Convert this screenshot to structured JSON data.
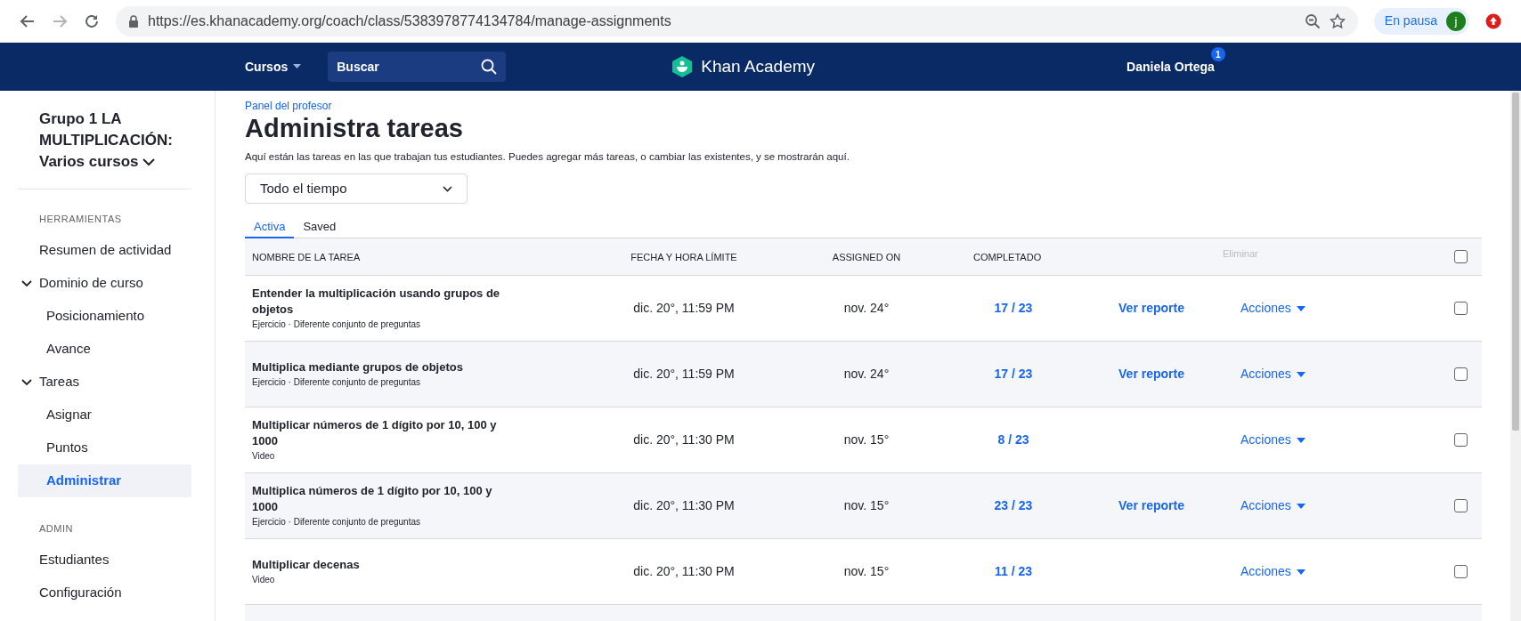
{
  "browser": {
    "url": "https://es.khanacademy.org/coach/class/5383978774134784/manage-assignments",
    "profile_status": "En pausa",
    "avatar_letter": "j"
  },
  "header": {
    "courses_menu": "Cursos",
    "search_placeholder": "Buscar",
    "logo": "Khan Academy",
    "user": "Daniela Ortega",
    "notification_count": "1"
  },
  "sidebar": {
    "class_title": "Grupo 1 LA MULTIPLICACIÓN: Varios cursos",
    "sections": [
      {
        "heading": "HERRAMIENTAS",
        "items": [
          {
            "label": "Resumen de actividad",
            "selected": false
          },
          {
            "label": "Dominio de curso",
            "selected": false,
            "expanded": true,
            "children": [
              {
                "label": "Posicionamiento",
                "selected": false
              },
              {
                "label": "Avance",
                "selected": false
              }
            ]
          },
          {
            "label": "Tareas",
            "selected": false,
            "expanded": true,
            "children": [
              {
                "label": "Asignar",
                "selected": false
              },
              {
                "label": "Puntos",
                "selected": false
              },
              {
                "label": "Administrar",
                "selected": true
              }
            ]
          }
        ]
      },
      {
        "heading": "ADMIN",
        "items": [
          {
            "label": "Estudiantes",
            "selected": false
          },
          {
            "label": "Configuración",
            "selected": false
          }
        ]
      }
    ]
  },
  "main": {
    "breadcrumb": "Panel del profesor",
    "title": "Administra tareas",
    "description": "Aquí están las tareas en las que trabajan tus estudiantes. Puedes agregar más tareas, o cambiar las existentes, y se mostrarán aquí.",
    "filter": {
      "value": "Todo el tiempo"
    },
    "tabs": [
      {
        "label": "Activa",
        "selected": true
      },
      {
        "label": "Saved",
        "selected": false
      }
    ],
    "table": {
      "columns": [
        "NOMBRE DE LA TAREA",
        "FECHA Y HORA LÍMITE",
        "ASSIGNED ON",
        "COMPLETADO"
      ],
      "delete_header": {
        "label": "Eliminar",
        "disabled": true
      },
      "select_all": {
        "checked": false
      },
      "rows": [
        {
          "name": "Entender la multiplicación usando grupos de objetos",
          "type": "Ejercicio · Diferente conjunto de preguntas",
          "due": "dic. 20°, 11:59 PM",
          "assigned": "nov. 24°",
          "completed": "17 / 23",
          "report": "Ver reporte",
          "actions": "Acciones",
          "checked": false
        },
        {
          "name": "Multiplica mediante grupos de objetos",
          "type": "Ejercicio · Diferente conjunto de preguntas",
          "due": "dic. 20°, 11:59 PM",
          "assigned": "nov. 24°",
          "completed": "17 / 23",
          "report": "Ver reporte",
          "actions": "Acciones",
          "checked": false
        },
        {
          "name": "Multiplicar números de 1 dígito por 10, 100 y 1000",
          "type": "Video",
          "due": "dic. 20°, 11:30 PM",
          "assigned": "nov. 15°",
          "completed": "8 / 23",
          "actions": "Acciones",
          "checked": false
        },
        {
          "name": "Multiplica números de 1 dígito por 10, 100 y 1000",
          "type": "Ejercicio · Diferente conjunto de preguntas",
          "due": "dic. 20°, 11:30 PM",
          "assigned": "nov. 15°",
          "completed": "23 / 23",
          "report": "Ver reporte",
          "actions": "Acciones",
          "checked": false
        },
        {
          "name": "Multiplicar decenas",
          "type": "Video",
          "due": "dic. 20°, 11:30 PM",
          "assigned": "nov. 15°",
          "completed": "11 / 23",
          "actions": "Acciones",
          "checked": false
        }
      ]
    }
  }
}
